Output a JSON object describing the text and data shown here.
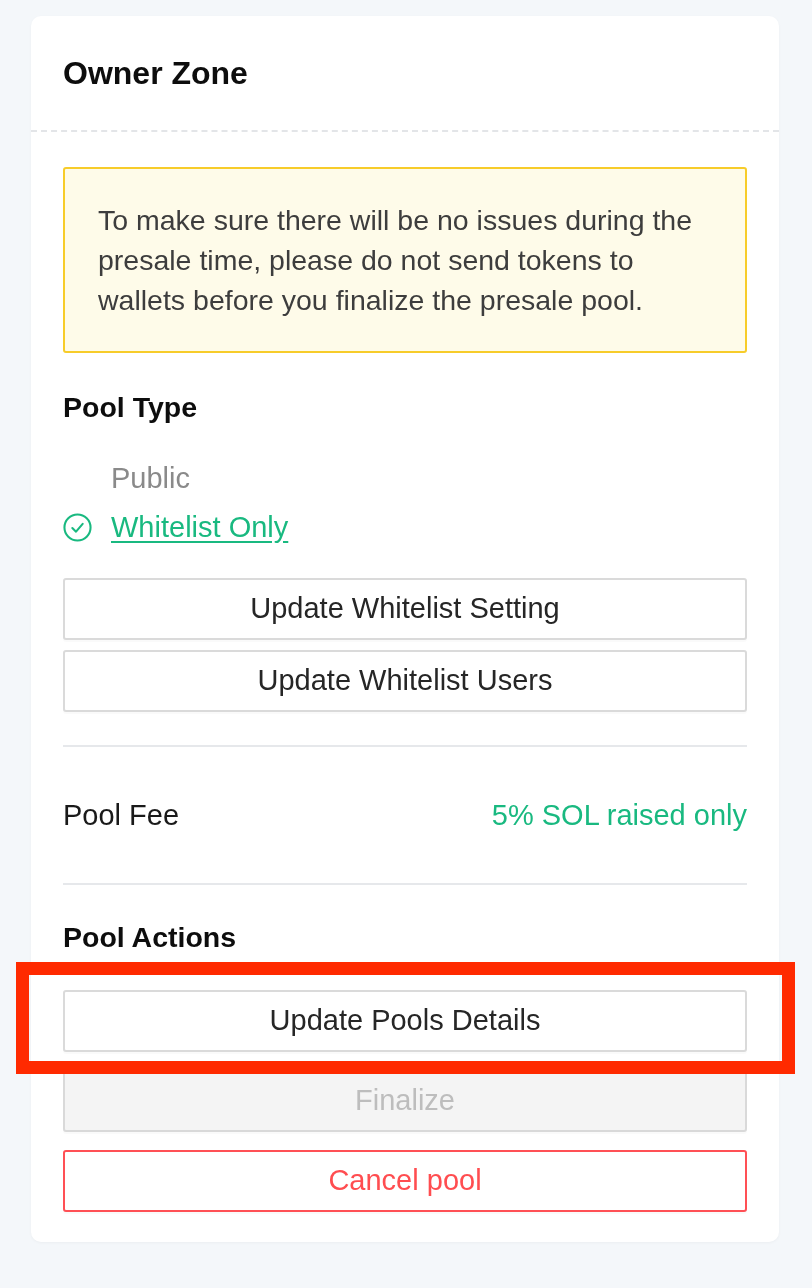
{
  "card": {
    "title": "Owner Zone"
  },
  "notice": {
    "text": "To make sure there will be no issues during the presale time, please do not send tokens to wallets before you finalize the presale pool."
  },
  "pool_type": {
    "heading": "Pool Type",
    "options": [
      {
        "label": "Public",
        "selected": false
      },
      {
        "label": "Whitelist Only",
        "selected": true
      }
    ],
    "buttons": [
      "Update Whitelist Setting",
      "Update Whitelist Users"
    ]
  },
  "pool_fee": {
    "label": "Pool Fee",
    "value": "5% SOL raised only"
  },
  "pool_actions": {
    "heading": "Pool Actions",
    "buttons": [
      {
        "label": "Update Pools Details",
        "kind": "default",
        "disabled": false,
        "highlighted": true
      },
      {
        "label": "Finalize",
        "kind": "default",
        "disabled": true,
        "highlighted": false
      },
      {
        "label": "Cancel pool",
        "kind": "danger",
        "disabled": false,
        "highlighted": false
      }
    ]
  }
}
